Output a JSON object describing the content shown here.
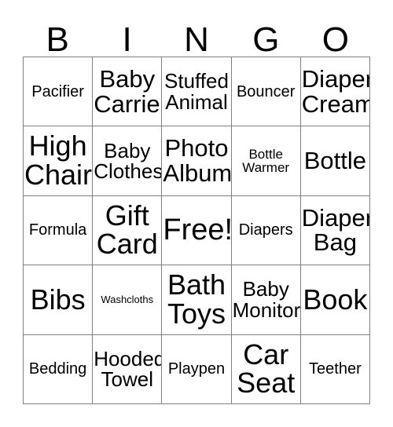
{
  "card": {
    "title_letters": [
      "B",
      "I",
      "N",
      "G",
      "O"
    ],
    "columns": 5,
    "rows": 5,
    "border_color": "#808080",
    "background_color": "#ffffff",
    "text_color": "#000000",
    "free_space_label": "Free!",
    "cells": [
      [
        {
          "label": "Pacifier",
          "size": "md"
        },
        {
          "label": "Baby\nCarrier",
          "size": "xl"
        },
        {
          "label": "Stuffed\nAnimal",
          "size": "lg"
        },
        {
          "label": "Bouncer",
          "size": "md"
        },
        {
          "label": "Diaper\nCream",
          "size": "xl"
        }
      ],
      [
        {
          "label": "High\nChair",
          "size": "xxl"
        },
        {
          "label": "Baby\nClothes",
          "size": "lg"
        },
        {
          "label": "Photo\nAlbum",
          "size": "xl"
        },
        {
          "label": "Bottle\nWarmer",
          "size": "sm"
        },
        {
          "label": "Bottle",
          "size": "xl"
        }
      ],
      [
        {
          "label": "Formula",
          "size": "md"
        },
        {
          "label": "Gift\nCard",
          "size": "xxl"
        },
        {
          "label": "Free!",
          "size": "free"
        },
        {
          "label": "Diapers",
          "size": "md"
        },
        {
          "label": "Diaper\nBag",
          "size": "xl"
        }
      ],
      [
        {
          "label": "Bibs",
          "size": "xxl"
        },
        {
          "label": "Washcloths",
          "size": "xs"
        },
        {
          "label": "Bath\nToys",
          "size": "xxl"
        },
        {
          "label": "Baby\nMonitor",
          "size": "lg"
        },
        {
          "label": "Book",
          "size": "xxl"
        }
      ],
      [
        {
          "label": "Bedding",
          "size": "md"
        },
        {
          "label": "Hooded\nTowel",
          "size": "lg"
        },
        {
          "label": "Playpen",
          "size": "md"
        },
        {
          "label": "Car\nSeat",
          "size": "xxl"
        },
        {
          "label": "Teether",
          "size": "md"
        }
      ]
    ]
  }
}
